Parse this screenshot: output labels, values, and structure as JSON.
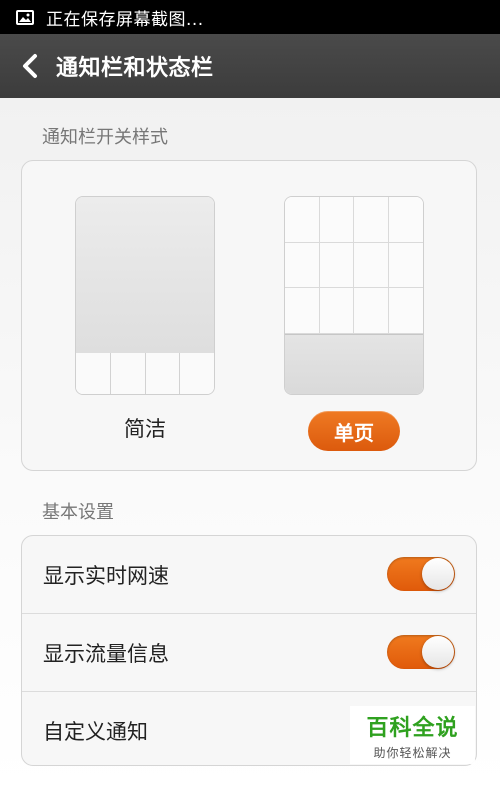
{
  "status_bar": {
    "text": "正在保存屏幕截图..."
  },
  "header": {
    "title": "通知栏和状态栏"
  },
  "notification_style": {
    "section_label": "通知栏开关样式",
    "options": [
      {
        "label": "简洁",
        "selected": false
      },
      {
        "label": "单页",
        "selected": true
      }
    ]
  },
  "basic_settings": {
    "section_label": "基本设置",
    "items": [
      {
        "label": "显示实时网速",
        "toggle_on": true
      },
      {
        "label": "显示流量信息",
        "toggle_on": true
      },
      {
        "label": "自定义通知"
      }
    ]
  },
  "watermark": {
    "main": "百科全说",
    "sub": "助你轻松解决"
  },
  "colors": {
    "accent": "#e8661a",
    "titlebar": "#424242",
    "statusbar": "#000000",
    "watermark_green": "#2fa11f"
  }
}
